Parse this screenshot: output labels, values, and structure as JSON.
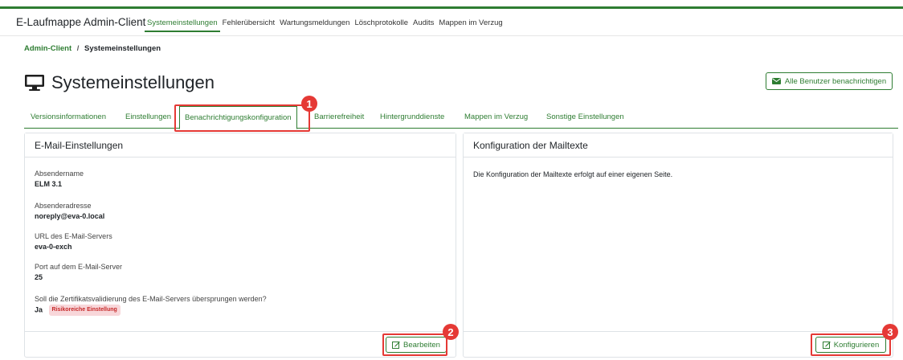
{
  "app": {
    "brand": "E-Laufmappe Admin-Client"
  },
  "nav": {
    "items": [
      {
        "label": "Systemeinstellungen",
        "active": true
      },
      {
        "label": "Fehlerübersicht",
        "active": false
      },
      {
        "label": "Wartungsmeldungen",
        "active": false
      },
      {
        "label": "Löschprotokolle",
        "active": false
      },
      {
        "label": "Audits",
        "active": false
      },
      {
        "label": "Mappen im Verzug",
        "active": false
      }
    ]
  },
  "breadcrumb": {
    "root": "Admin-Client",
    "separator": "/",
    "current": "Systemeinstellungen"
  },
  "page": {
    "title": "Systemeinstellungen",
    "title_icon": "monitor-icon",
    "notify_button": "Alle Benutzer benachrichtigen",
    "notify_icon": "envelope-icon"
  },
  "tabs": [
    {
      "label": "Versionsinformationen",
      "active": false
    },
    {
      "label": "Einstellungen",
      "active": false
    },
    {
      "label": "Benachrichtigungskonfiguration",
      "active": true
    },
    {
      "label": "Barrierefreiheit",
      "active": false
    },
    {
      "label": "Hintergrunddienste",
      "active": false
    },
    {
      "label": "Mappen im Verzug",
      "active": false
    },
    {
      "label": "Sonstige Einstellungen",
      "active": false
    }
  ],
  "email_card": {
    "title": "E-Mail-Einstellungen",
    "fields": [
      {
        "label": "Absendername",
        "value": "ELM 3.1"
      },
      {
        "label": "Absenderadresse",
        "value": "noreply@eva-0.local"
      },
      {
        "label": "URL des E-Mail-Servers",
        "value": "eva-0-exch"
      },
      {
        "label": "Port auf dem E-Mail-Server",
        "value": "25"
      },
      {
        "label": "Soll die Zertifikatsvalidierung des E-Mail-Servers übersprungen werden?",
        "value": "Ja",
        "badge": "Risikoreiche Einstellung"
      }
    ],
    "edit_button": "Bearbeiten"
  },
  "mailtext_card": {
    "title": "Konfiguration der Mailtexte",
    "text": "Die Konfiguration der Mailtexte erfolgt auf einer eigenen Seite.",
    "configure_button": "Konfigurieren"
  },
  "markers": [
    "1",
    "2",
    "3"
  ],
  "colors": {
    "accent": "#2e7d32",
    "highlight": "#e53935",
    "badge_bg": "#f8d7da",
    "badge_text": "#c62828"
  }
}
